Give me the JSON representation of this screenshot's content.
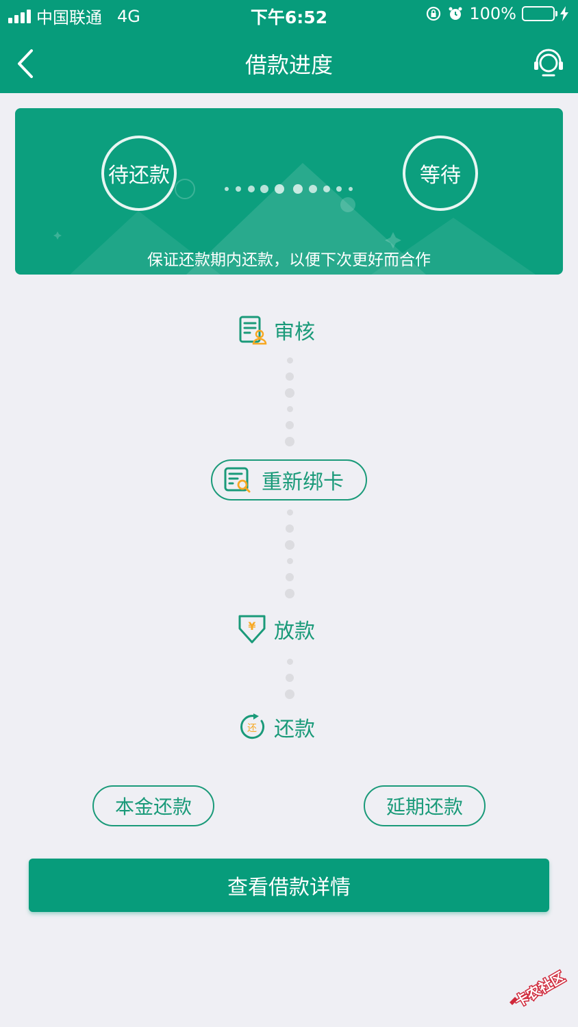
{
  "status_bar": {
    "carrier": "中国联通",
    "network": "4G",
    "time": "下午6:52",
    "battery": "100%"
  },
  "nav": {
    "title": "借款进度",
    "back_icon": "chevron-left-icon",
    "service_icon": "headset-icon"
  },
  "banner": {
    "current_status": "待还款",
    "next_status": "等待",
    "tip": "保证还款期内还款，以便下次更好而合作"
  },
  "steps": [
    {
      "label": "审核",
      "icon": "document-user-icon"
    },
    {
      "label": "重新绑卡",
      "icon": "document-search-icon"
    },
    {
      "label": "放款",
      "icon": "yen-download-icon"
    },
    {
      "label": "还款",
      "icon": "repay-circle-icon"
    }
  ],
  "actions": {
    "principal_repay": "本金还款",
    "extend_repay": "延期还款",
    "view_details": "查看借款详情"
  },
  "colors": {
    "primary": "#079c7b",
    "accent": "#f7a823",
    "background": "#efeff4"
  }
}
